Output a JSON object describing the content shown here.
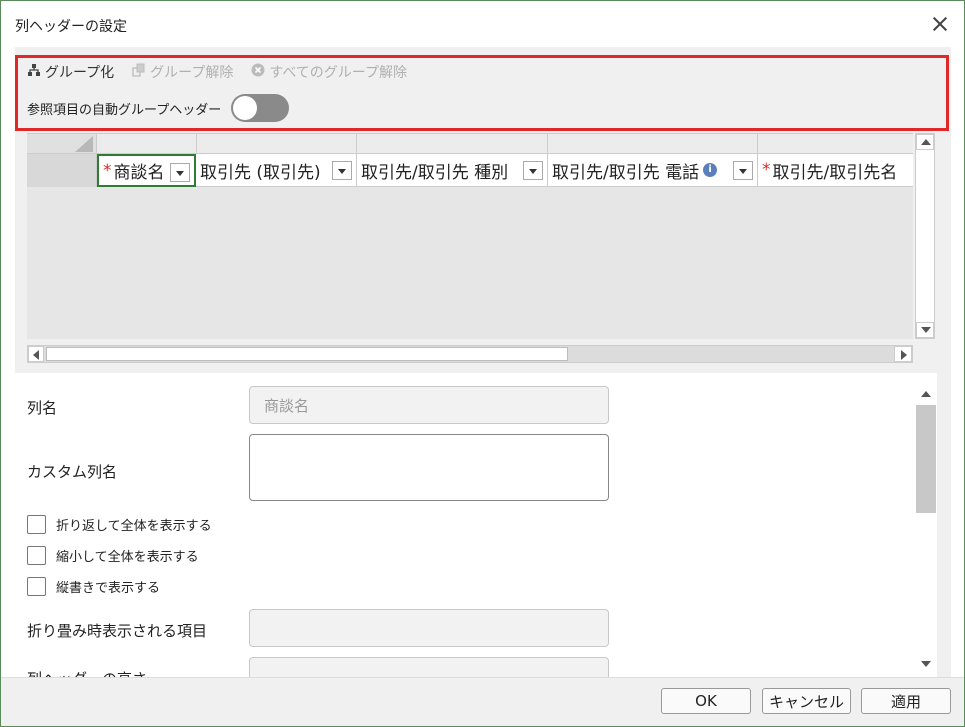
{
  "dialog": {
    "title": "列ヘッダーの設定"
  },
  "toolbar": {
    "group_label": "グループ化",
    "ungroup_label": "グループ解除",
    "ungroup_all_label": "すべてのグループ解除"
  },
  "toggle": {
    "label": "参照項目の自動グループヘッダー",
    "on": false
  },
  "grid": {
    "columns": [
      {
        "label": "商談名",
        "required": true,
        "selected": true,
        "info": false
      },
      {
        "label": "取引先 (取引先)",
        "required": false,
        "selected": false,
        "info": false
      },
      {
        "label": "取引先/取引先 種別",
        "required": false,
        "selected": false,
        "info": false
      },
      {
        "label": "取引先/取引先 電話",
        "required": false,
        "selected": false,
        "info": true
      },
      {
        "label": "取引先/取引先名",
        "required": true,
        "selected": false,
        "info": false
      }
    ],
    "required_mark": "*"
  },
  "form": {
    "column_name_label": "列名",
    "column_name_value": "商談名",
    "custom_name_label": "カスタム列名",
    "custom_name_value": "",
    "checkboxes": [
      {
        "label": "折り返して全体を表示する",
        "checked": false
      },
      {
        "label": "縮小して全体を表示する",
        "checked": false
      },
      {
        "label": "縦書きで表示する",
        "checked": false
      }
    ],
    "collapsed_label": "折り畳み時表示される項目",
    "collapsed_value": "",
    "height_label": "列ヘッダーの高さ",
    "height_value": ""
  },
  "footer": {
    "ok_label": "OK",
    "cancel_label": "キャンセル",
    "apply_label": "適用"
  },
  "colors": {
    "highlight": "#e02828",
    "selected_border": "#2e7d32",
    "required": "#d32f2f",
    "toggle_off": "#8a8a8a"
  },
  "icons": {
    "group": "hierarchy-icon",
    "ungroup": "ungroup-icon",
    "ungroup_all": "circle-x-icon",
    "info": "info-icon",
    "close": "close-icon"
  }
}
